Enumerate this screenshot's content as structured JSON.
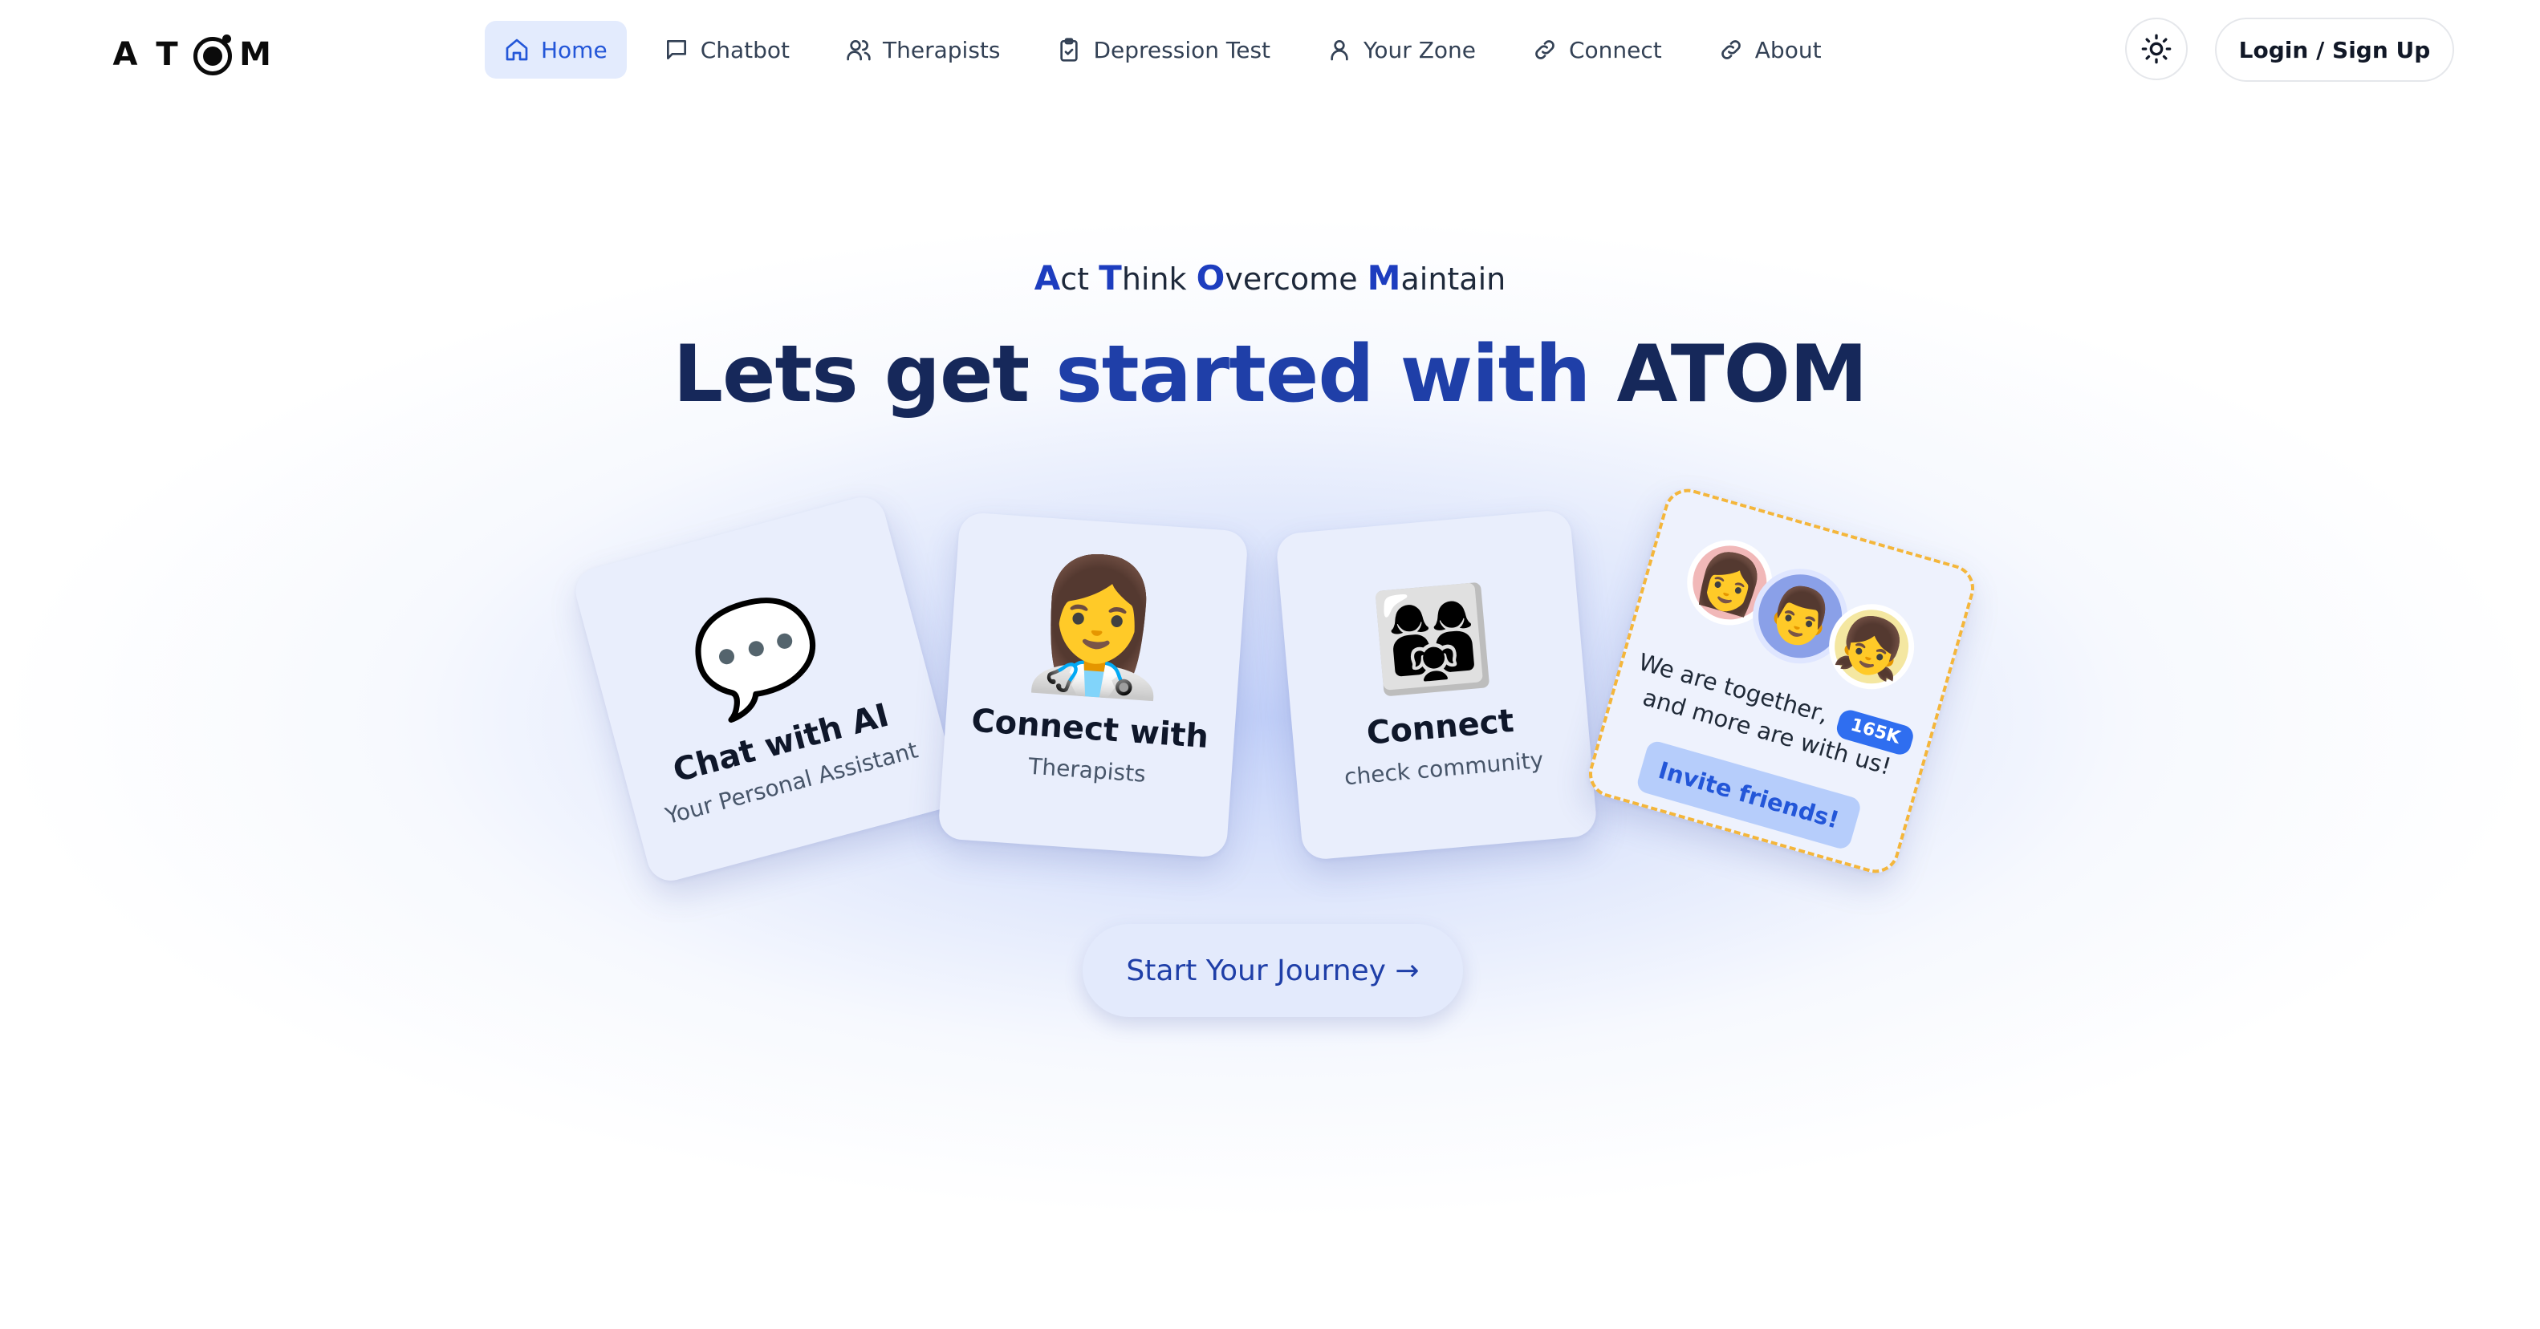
{
  "brand": {
    "logo_letters": [
      "A",
      "T",
      "M"
    ]
  },
  "nav": {
    "items": [
      {
        "label": "Home",
        "icon": "home-icon",
        "active": true
      },
      {
        "label": "Chatbot",
        "icon": "chat-bubble-icon"
      },
      {
        "label": "Therapists",
        "icon": "users-icon"
      },
      {
        "label": "Depression Test",
        "icon": "clipboard-icon"
      },
      {
        "label": "Your Zone",
        "icon": "user-icon"
      },
      {
        "label": "Connect",
        "icon": "link-icon"
      },
      {
        "label": "About",
        "icon": "link-icon"
      }
    ]
  },
  "header": {
    "theme_toggle_icon": "sun-icon",
    "login_label": "Login / Sign Up"
  },
  "hero": {
    "tagline": [
      {
        "cap": "A",
        "rest": "ct"
      },
      {
        "cap": "T",
        "rest": "hink"
      },
      {
        "cap": "O",
        "rest": "vercome"
      },
      {
        "cap": "M",
        "rest": "aintain"
      }
    ],
    "title_part1": "Lets get",
    "title_accent": "started with",
    "title_part2": "ATOM"
  },
  "cards": {
    "chat": {
      "emoji": "💬",
      "title": "Chat with AI",
      "subtitle": "Your Personal Assistant"
    },
    "therapists": {
      "emoji": "👩‍⚕️",
      "title": "Connect with",
      "subtitle": "Therapists"
    },
    "community": {
      "emoji": "👩‍👩‍👧",
      "title": "Connect",
      "subtitle": "check community"
    },
    "invite": {
      "avatars": [
        "👩",
        "👨",
        "👧"
      ],
      "line1": "We are together,",
      "badge": "165K",
      "line2": "and more are with us!",
      "button": "Invite friends!"
    }
  },
  "cta": {
    "label": "Start Your Journey →"
  },
  "colors": {
    "accent": "#1f3fa8",
    "title_dark": "#16285a",
    "nav_active_bg": "#e3ebfd",
    "card_bg": "#e9eefc",
    "invite_border": "#f4b63b",
    "badge": "#2f6ef0"
  }
}
